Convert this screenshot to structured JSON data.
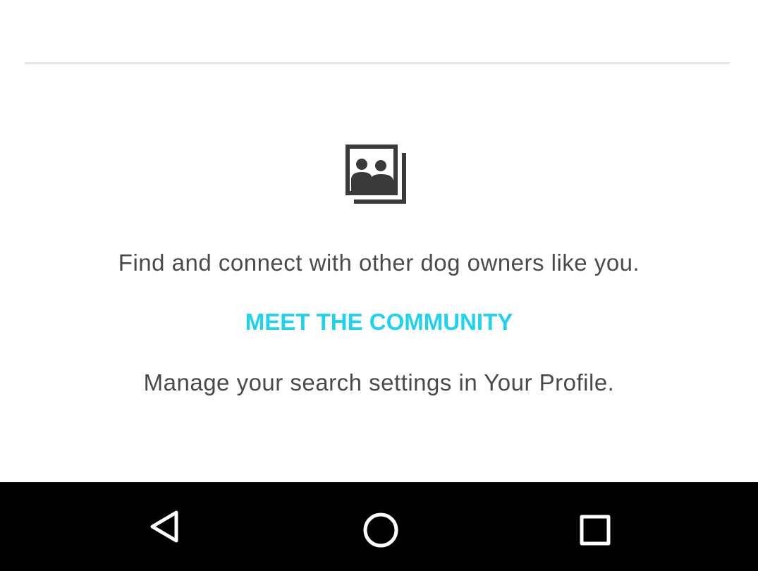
{
  "empty_state": {
    "icon": "photo-library-people-icon",
    "message": "Find and connect with other dog owners like you.",
    "cta_label": "MEET THE COMMUNITY",
    "hint": "Manage your search settings in Your Profile."
  },
  "navigation_bar": {
    "back_icon": "back-triangle-icon",
    "home_icon": "home-circle-icon",
    "recents_icon": "recents-square-icon"
  },
  "colors": {
    "accent": "#21d3ea",
    "text": "#4a4a4a",
    "icon": "#3a3a3a",
    "navbar": "#000000"
  }
}
